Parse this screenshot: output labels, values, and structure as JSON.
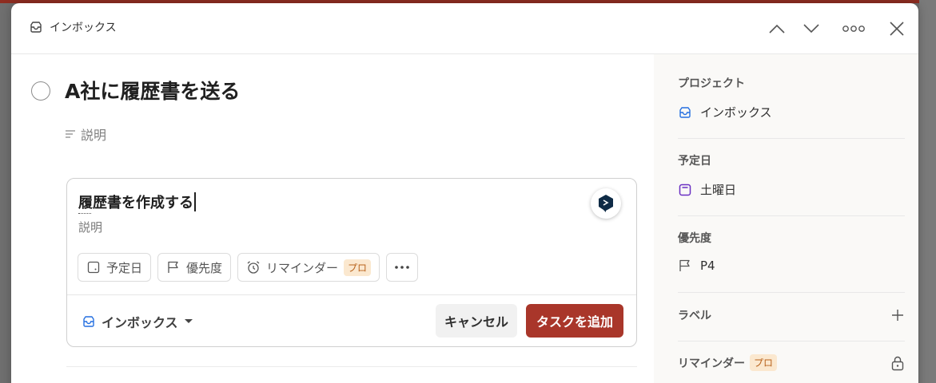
{
  "header": {
    "breadcrumb_label": "インボックス",
    "icons": [
      "inbox-icon",
      "chevron-up-icon",
      "chevron-down-icon",
      "more-icon",
      "close-icon"
    ]
  },
  "task": {
    "title": "A社に履歴書を送る",
    "description_placeholder": "説明"
  },
  "subtask_editor": {
    "name": "履歴書を作成する",
    "description_placeholder": "説明",
    "chips": {
      "due_date": "予定日",
      "priority": "優先度",
      "reminder": "リマインダー",
      "reminder_badge": "プロ"
    },
    "project": "インボックス",
    "cancel_label": "キャンセル",
    "add_label": "タスクを追加"
  },
  "sidebar": {
    "project_label": "プロジェクト",
    "project_value": "インボックス",
    "due_label": "予定日",
    "due_value": "土曜日",
    "priority_label": "優先度",
    "priority_value": "P4",
    "labels_label": "ラベル",
    "reminders_label": "リマインダー",
    "reminders_badge": "プロ"
  },
  "colors": {
    "accent_red": "#a9362a",
    "project_blue": "#246fe0",
    "date_purple": "#692fc2",
    "pro_badge_bg": "#fbe8cf",
    "pro_badge_text": "#b8621b"
  }
}
